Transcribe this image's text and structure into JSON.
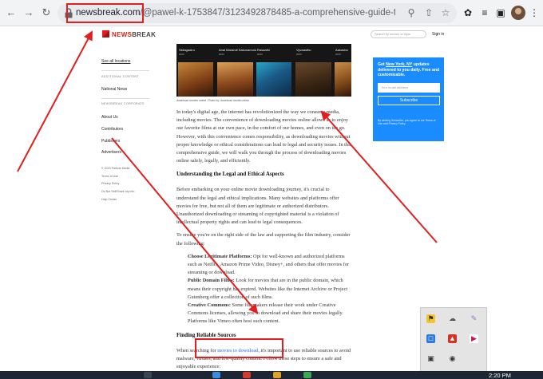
{
  "browser": {
    "url_host": "newsbreak.com",
    "url_path": "/@p​awel-k-1753847/3123492878485-a-comprehensive-guide-to-downloading-..."
  },
  "site": {
    "logo_text_main": "NEWS",
    "logo_text_rest": "BREAK",
    "search_placeholder": "Search by source or topic",
    "signin": "Sign in"
  },
  "rail": {
    "see_locations": "See all locations",
    "additional_heading": "ADDITIONAL CONTENT",
    "national_news": "National News",
    "corporate_heading": "NEWSBREAK CORPORATE",
    "about": "About Us",
    "contributors": "Contributors",
    "publishers": "Publishers",
    "advertisers": "Advertisers",
    "copyright": "© 2023 Particle Media",
    "terms": "Terms of Use",
    "privacy": "Privacy Policy",
    "do_not_sell": "Do Not Sell/Share my info",
    "help": "Help Center"
  },
  "strip": {
    "posters": [
      {
        "title": "Skilagaalru",
        "year": "2023"
      },
      {
        "title": "Anal Marandi Sakunamulu",
        "year": "2023"
      },
      {
        "title": "Rasaathi",
        "year": "2023"
      },
      {
        "title": "Vyvaasthu",
        "year": "2023"
      },
      {
        "title": "Aakasha",
        "year": "2023"
      }
    ],
    "caption_text": "download movies online",
    "caption_credit": "Photo by: download media online"
  },
  "article": {
    "p1": "In today's digital age, the internet has revolutionized the way we consume media, including movies. The convenience of downloading movies online allows us to enjoy our favorite films at our own pace, in the comfort of our homes, and even on the go. However, with this convenience comes responsibility, as downloading movies without proper knowledge or ethical considerations can lead to legal and security issues. In this comprehensive guide, we will walk you through the process of downloading movies online safely, legally, and efficiently.",
    "h1": "Understanding the Legal and Ethical Aspects",
    "p2": "Before embarking on your online movie downloading journey, it's crucial to understand the legal and ethical implications. Many websites and platforms offer movies for free, but not all of them are legitimate or authorized distributors. Unauthorized downloading or streaming of copyrighted material is a violation of intellectual property rights and can lead to legal consequences.",
    "p3": "To ensure you're on the right side of the law and supporting the film industry, consider the following:",
    "li1_label": "Choose Legitimate Platforms:",
    "li1_text": " Opt for well-known and authorized platforms such as Netflix, Amazon Prime Video, Disney+, and others that offer movies for streaming or download.",
    "li2_label": "Public Domain Films:",
    "li2_text": " Look for movies that are in the public domain, which means their copyright has expired. Websites like the Internet Archive or Project Gutenberg offer a collection of such films.",
    "li3_label": "Creative Commons:",
    "li3_text": " Some filmmakers release their work under Creative Commons licenses, allowing you to download and share their movies legally. Platforms like Vimeo often host such content.",
    "h2": "Finding Reliable Sources",
    "p4_a": "When searching for ",
    "p4_link": "movies to download",
    "p4_b": ", it's important to use reliable sources to avoid malware, viruses, and low-quality content. Follow these steps to ensure a safe and enjoyable experience:"
  },
  "card": {
    "title_a": "Get ",
    "title_link": "New York, NY",
    "title_b": " updates delivered to you daily. Free and customizable.",
    "email_placeholder": "Your email address",
    "subscribe": "Subscribe",
    "fine_print": "By clicking Subscribe, you agree to our Terms of Use and Privacy Policy."
  },
  "taskbar": {
    "time": "2:20 PM"
  },
  "colors": {
    "annotation": "#e41e1e",
    "brand": "#d2271d",
    "card_bg": "#1a8cff"
  }
}
